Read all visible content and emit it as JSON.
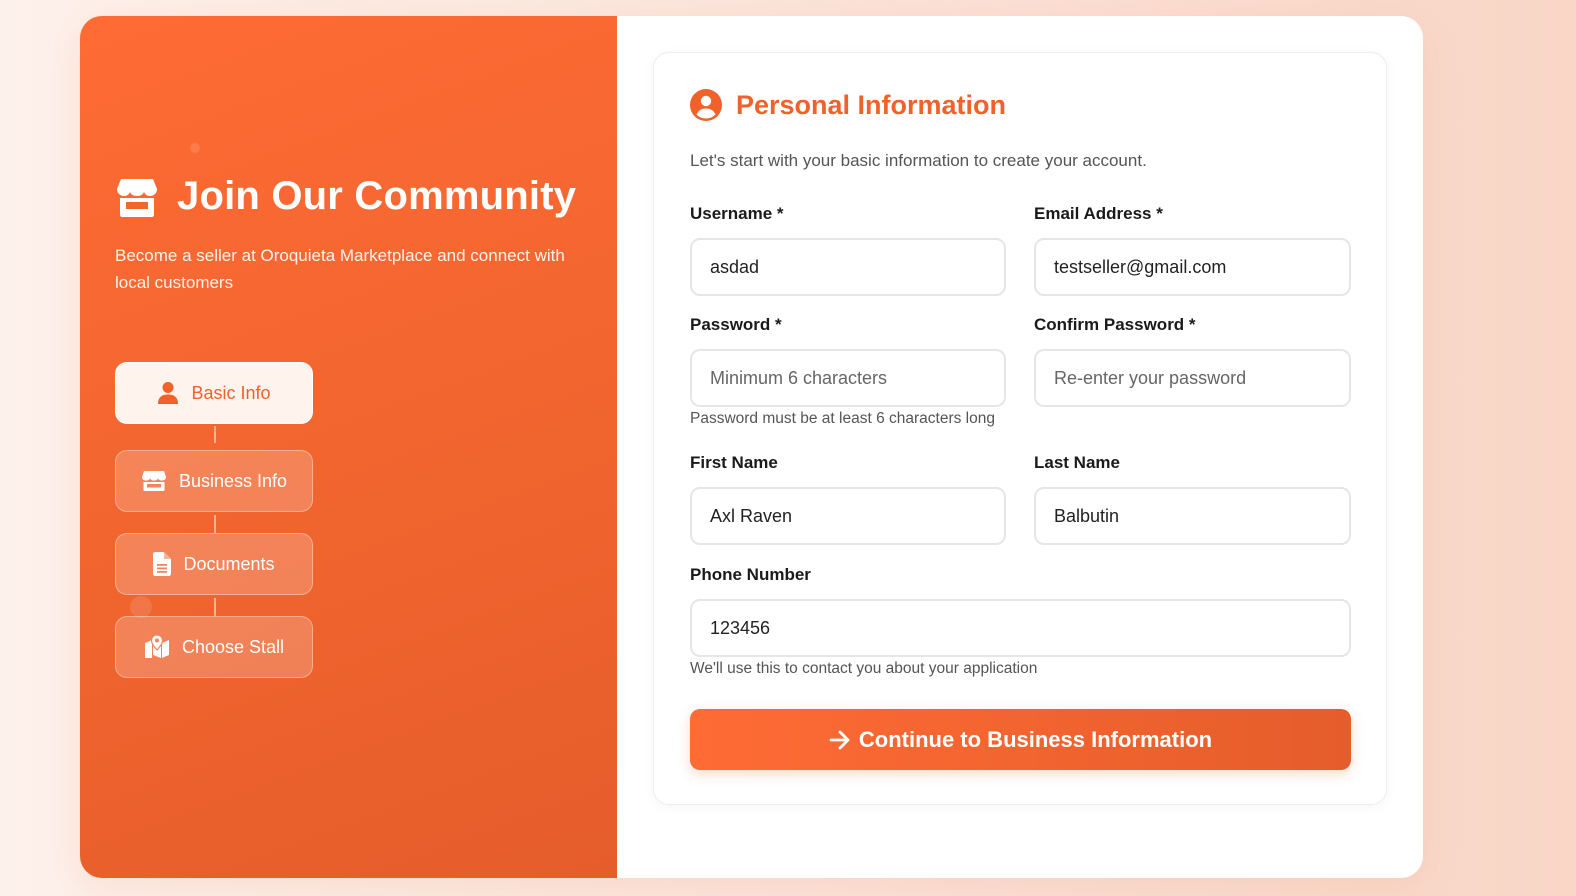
{
  "sidebar": {
    "title": "Join Our Community",
    "subtitle": "Become a seller at Oroquieta Marketplace and connect with local customers",
    "steps": [
      {
        "label": "Basic Info",
        "icon": "user-icon",
        "active": true
      },
      {
        "label": "Business Info",
        "icon": "store-icon",
        "active": false
      },
      {
        "label": "Documents",
        "icon": "document-icon",
        "active": false
      },
      {
        "label": "Choose Stall",
        "icon": "map-pin-icon",
        "active": false
      }
    ]
  },
  "form": {
    "section_title": "Personal Information",
    "section_icon": "user-circle-icon",
    "description": "Let's start with your basic information to create your account.",
    "username": {
      "label": "Username *",
      "value": "asdad"
    },
    "email": {
      "label": "Email Address *",
      "value": "testseller@gmail.com"
    },
    "password": {
      "label": "Password *",
      "placeholder": "Minimum 6 characters",
      "hint": "Password must be at least 6 characters long"
    },
    "confirm_password": {
      "label": "Confirm Password *",
      "placeholder": "Re-enter your password"
    },
    "first_name": {
      "label": "First Name",
      "value": "Axl Raven"
    },
    "last_name": {
      "label": "Last Name",
      "value": "Balbutin"
    },
    "phone": {
      "label": "Phone Number",
      "value": "123456",
      "hint": "We'll use this to contact you about your application"
    },
    "submit_label": "Continue to Business Information",
    "submit_icon": "arrow-right-icon"
  },
  "colors": {
    "accent": "#f0622a",
    "accent_light": "#ff6b35",
    "accent_dark": "#e55d2b",
    "background": "#fdf1eb"
  }
}
